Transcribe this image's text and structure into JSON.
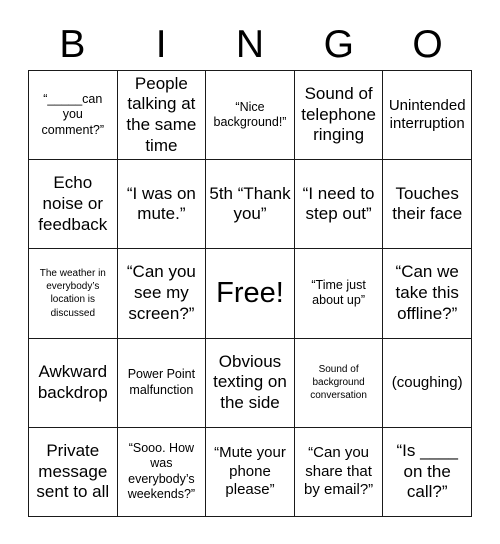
{
  "card": {
    "title": "BINGO",
    "header_letters": [
      "B",
      "I",
      "N",
      "G",
      "O"
    ],
    "free_space_label": "Free!",
    "colors": {
      "background": "#ffffff",
      "text": "#000000",
      "grid_line": "#1a1a1a"
    },
    "grid": {
      "columns": 5,
      "rows": 5,
      "cells": [
        {
          "id": "b1",
          "text": "“_____can you comment?”",
          "size": "sm"
        },
        {
          "id": "i1",
          "text": "People talking at the same time",
          "size": "lg"
        },
        {
          "id": "n1",
          "text": "“Nice background!”",
          "size": "sm"
        },
        {
          "id": "g1",
          "text": "Sound of telephone ringing",
          "size": "lg"
        },
        {
          "id": "o1",
          "text": "Unintended interruption",
          "size": "md"
        },
        {
          "id": "b2",
          "text": "Echo noise or feedback",
          "size": "lg"
        },
        {
          "id": "i2",
          "text": "“I was on mute.”",
          "size": "lg"
        },
        {
          "id": "n2",
          "text": "5th “Thank you”",
          "size": "lg"
        },
        {
          "id": "g2",
          "text": "“I need to step out”",
          "size": "lg"
        },
        {
          "id": "o2",
          "text": "Touches their face",
          "size": "lg"
        },
        {
          "id": "b3",
          "text": "The weather in everybody’s location is discussed",
          "size": "xs"
        },
        {
          "id": "i3",
          "text": "“Can you see my screen?”",
          "size": "lg"
        },
        {
          "id": "n3",
          "text": "Free!",
          "size": "xl"
        },
        {
          "id": "g3",
          "text": "“Time just about up”",
          "size": "sm"
        },
        {
          "id": "o3",
          "text": "“Can we take this offline?”",
          "size": "lg"
        },
        {
          "id": "b4",
          "text": "Awkward backdrop",
          "size": "lg"
        },
        {
          "id": "i4",
          "text": "Power Point malfunction",
          "size": "sm"
        },
        {
          "id": "n4",
          "text": "Obvious texting on the side",
          "size": "lg"
        },
        {
          "id": "g4",
          "text": "Sound of background conversation",
          "size": "xs"
        },
        {
          "id": "o4",
          "text": "(coughing)",
          "size": "md"
        },
        {
          "id": "b5",
          "text": "Private message sent to all",
          "size": "lg"
        },
        {
          "id": "i5",
          "text": "“Sooo. How was everybody’s weekends?”",
          "size": "sm"
        },
        {
          "id": "n5",
          "text": "“Mute your phone please”",
          "size": "md"
        },
        {
          "id": "g5",
          "text": "“Can you share that by email?”",
          "size": "md"
        },
        {
          "id": "o5",
          "text": "“Is ____ on the call?”",
          "size": "lg"
        }
      ]
    }
  }
}
